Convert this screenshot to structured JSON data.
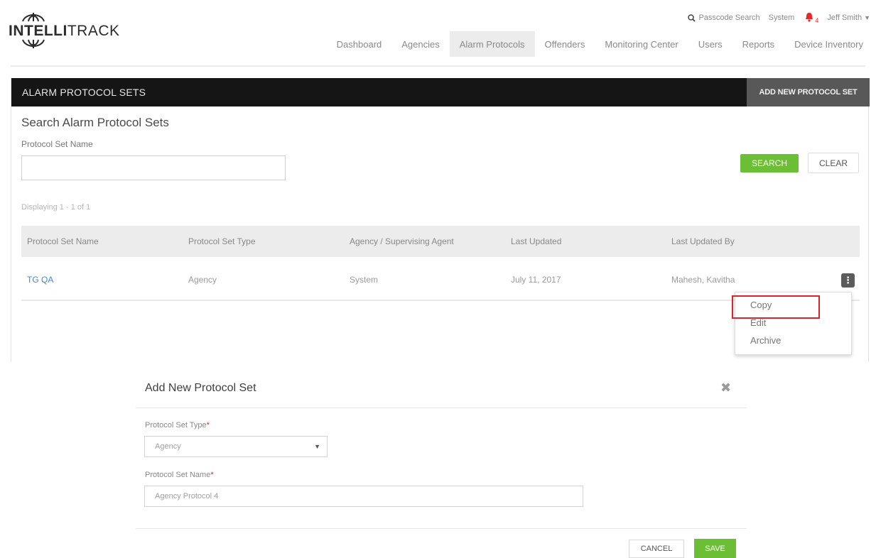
{
  "brand": {
    "logo_text_bold": "INTELLI",
    "logo_text_regular": "TRACK"
  },
  "utility": {
    "passcode_search": "Passcode Search",
    "system": "System",
    "notification_count": "4",
    "user_name": "Jeff Smith"
  },
  "nav": {
    "items": [
      "Dashboard",
      "Agencies",
      "Alarm Protocols",
      "Offenders",
      "Monitoring Center",
      "Users",
      "Reports",
      "Device Inventory"
    ],
    "active": "Alarm Protocols"
  },
  "panel": {
    "title": "ALARM PROTOCOL SETS",
    "add_button": "ADD NEW PROTOCOL SET"
  },
  "search": {
    "heading": "Search Alarm Protocol Sets",
    "field_label": "Protocol Set Name",
    "field_value": "",
    "search_button": "SEARCH",
    "clear_button": "CLEAR"
  },
  "results": {
    "displaying": "Displaying 1 - 1 of 1",
    "columns": [
      "Protocol Set Name",
      "Protocol Set Type",
      "Agency / Supervising Agent",
      "Last Updated",
      "Last Updated By"
    ],
    "rows": [
      {
        "name": "TG QA",
        "type": "Agency",
        "agency": "System",
        "updated": "July 11, 2017",
        "updated_by": "Mahesh, Kavitha"
      }
    ]
  },
  "row_menu": {
    "items": [
      "Copy",
      "Edit",
      "Archive"
    ],
    "highlighted": "Copy"
  },
  "modal": {
    "title": "Add New Protocol Set",
    "type_label": "Protocol Set Type",
    "type_value": "Agency",
    "name_label": "Protocol Set Name",
    "name_value": "Agency Protocol 4",
    "required_marker": "*",
    "cancel_button": "CANCEL",
    "save_button": "SAVE"
  },
  "colors": {
    "accent_green": "#6cbf35",
    "header_bar": "#151515",
    "link_blue": "#4c86c6",
    "alert_red": "#d9262c"
  }
}
